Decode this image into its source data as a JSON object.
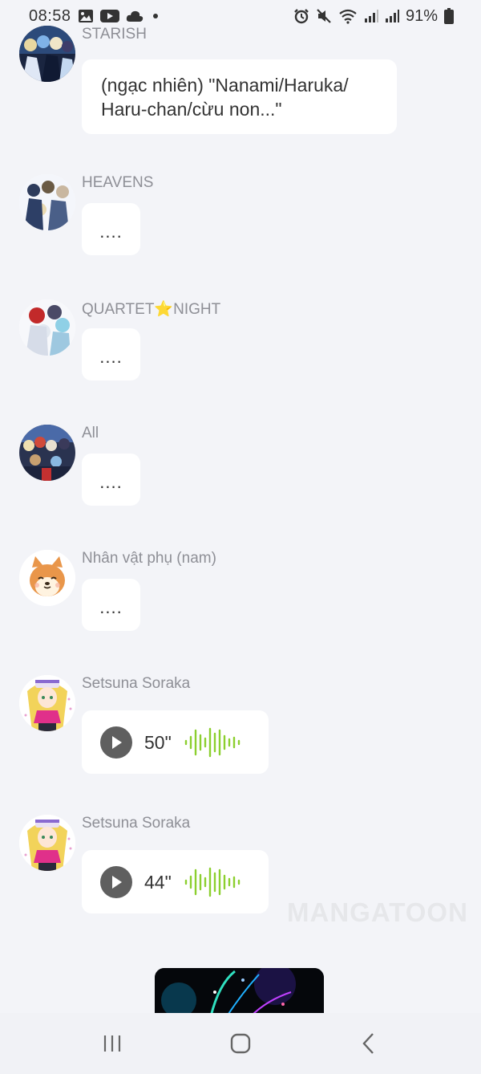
{
  "status_bar": {
    "time": "08:58",
    "battery": "91%",
    "icons": [
      "image-icon",
      "youtube-icon",
      "cloud-icon",
      "alarm-icon",
      "mute-icon",
      "wifi-icon",
      "signal-icon",
      "battery-icon"
    ]
  },
  "messages": [
    {
      "speaker": "STARISH",
      "type": "text",
      "text_lines": [
        "(ngạc nhiên) \"Nanami/Haruka/",
        "Haru-chan/cừu non...\""
      ]
    },
    {
      "speaker": "HEAVENS",
      "type": "text",
      "text": "...."
    },
    {
      "speaker": "QUARTET⭐NIGHT",
      "type": "text",
      "text": "...."
    },
    {
      "speaker": "All",
      "type": "text",
      "text": "...."
    },
    {
      "speaker": "Nhân vật phụ (nam)",
      "type": "text",
      "text": "...."
    },
    {
      "speaker": "Setsuna Soraka",
      "type": "audio",
      "duration": "50\""
    },
    {
      "speaker": "Setsuna Soraka",
      "type": "audio",
      "duration": "44\""
    }
  ],
  "watermark": "MANGATOON",
  "colors": {
    "background": "#f3f4f8",
    "speaker_text": "#8e8f96",
    "audio_wave": "#8ccf2f",
    "play_button": "#5f5f5f"
  },
  "nav_bar": {
    "buttons": [
      "recent-apps-icon",
      "home-icon",
      "back-icon"
    ]
  }
}
